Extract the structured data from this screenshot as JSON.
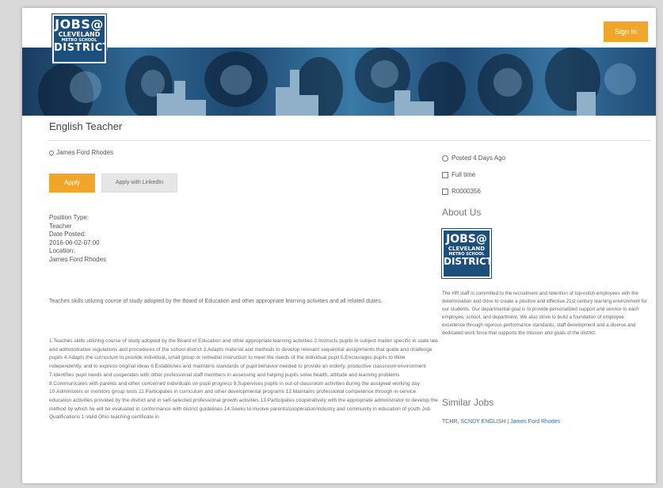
{
  "header": {
    "logo": {
      "line1": "JOBS@",
      "line2": "CLEVELAND",
      "line3": "METRO SCHOOL",
      "line4": "DISTRICT"
    },
    "signin_label": "Sign In"
  },
  "job": {
    "title": "English Teacher",
    "location": "James Ford Rhodes",
    "apply_label": "Apply",
    "linkedin_label": "Apply with LinkedIn",
    "details": {
      "position_type_label": "Position Type:",
      "position_type": "Teacher",
      "date_posted_label": "Date Posted:",
      "date_posted": "2016-06-02-07:00",
      "location_label": "Location:",
      "location_value": "James Ford Rhodes"
    },
    "summary": "Teaches skills utilizing course of study adopted by the Board of Education and other appropriate learning activities and all related duties.",
    "duties": "1.Teaches skills utilizing course of study adopted by the Board of Education and other appropriate learning activities 2.Instructs pupils in subject matter specific in state law and administrative regulations and procedures of the school district 3.Adapts material and methods to develop relevant sequential assignments that guide and challenge pupils 4.Adapts the curriculum to provide individual, small group or remedial instruction to meet the needs of the individual pupil 5.Encourages pupils to think independently, and to express original ideas 6.Establishes and maintains standards of pupil behavior needed to provide an orderly, productive classroom environment 7.Identifies pupil needs and cooperates with other professional staff members in assessing and helping pupils solve health, attitude and learning problems 8.Communicates with parents and other concerned individuals on pupil progress 9.Supervises pupils in out-of-classroom activities during the assigned working day 10.Administers or monitors group tests 11.Participates in curriculum and other developmental programs 12.Maintains professional competence through in-service education activities provided by the district and in self-selected professional growth activities 13.Participates cooperatively with the appropriate administrator to develop the method by which he will be evaluated in conformance with district guidelines 14.Seeks to involve parents/cooperation/industry and community in education of youth Job Qualifications 1.Valid Ohio teaching certificate in"
  },
  "sidebar": {
    "posted": "Posted 4 Days Ago",
    "time_type": "Full time",
    "req_id": "R0000356",
    "about_heading": "About Us",
    "about_text": "The HR staff is committed to the recruitment and retention of top-notch employees with the determination and drive to create a positive and effective 21st century learning environment for our students. Our departmental goal is to provide personalized support and service to each employee, school, and department. We also strive to build a foundation of employee excellence through rigorous performance standards, staff development and a diverse and dedicated work force that supports the mission and goals of the district.",
    "similar_heading": "Similar Jobs",
    "similar_link": "TCHR, SCNDY ENGLISH | James Ford Rhodes"
  },
  "colors": {
    "accent": "#efa629",
    "brand": "#1d4f7c",
    "link": "#2a6fb0"
  },
  "icons": {
    "location": "map-pin-icon",
    "posted": "clock-icon",
    "time_type": "calendar-icon",
    "req_id": "id-card-icon"
  }
}
